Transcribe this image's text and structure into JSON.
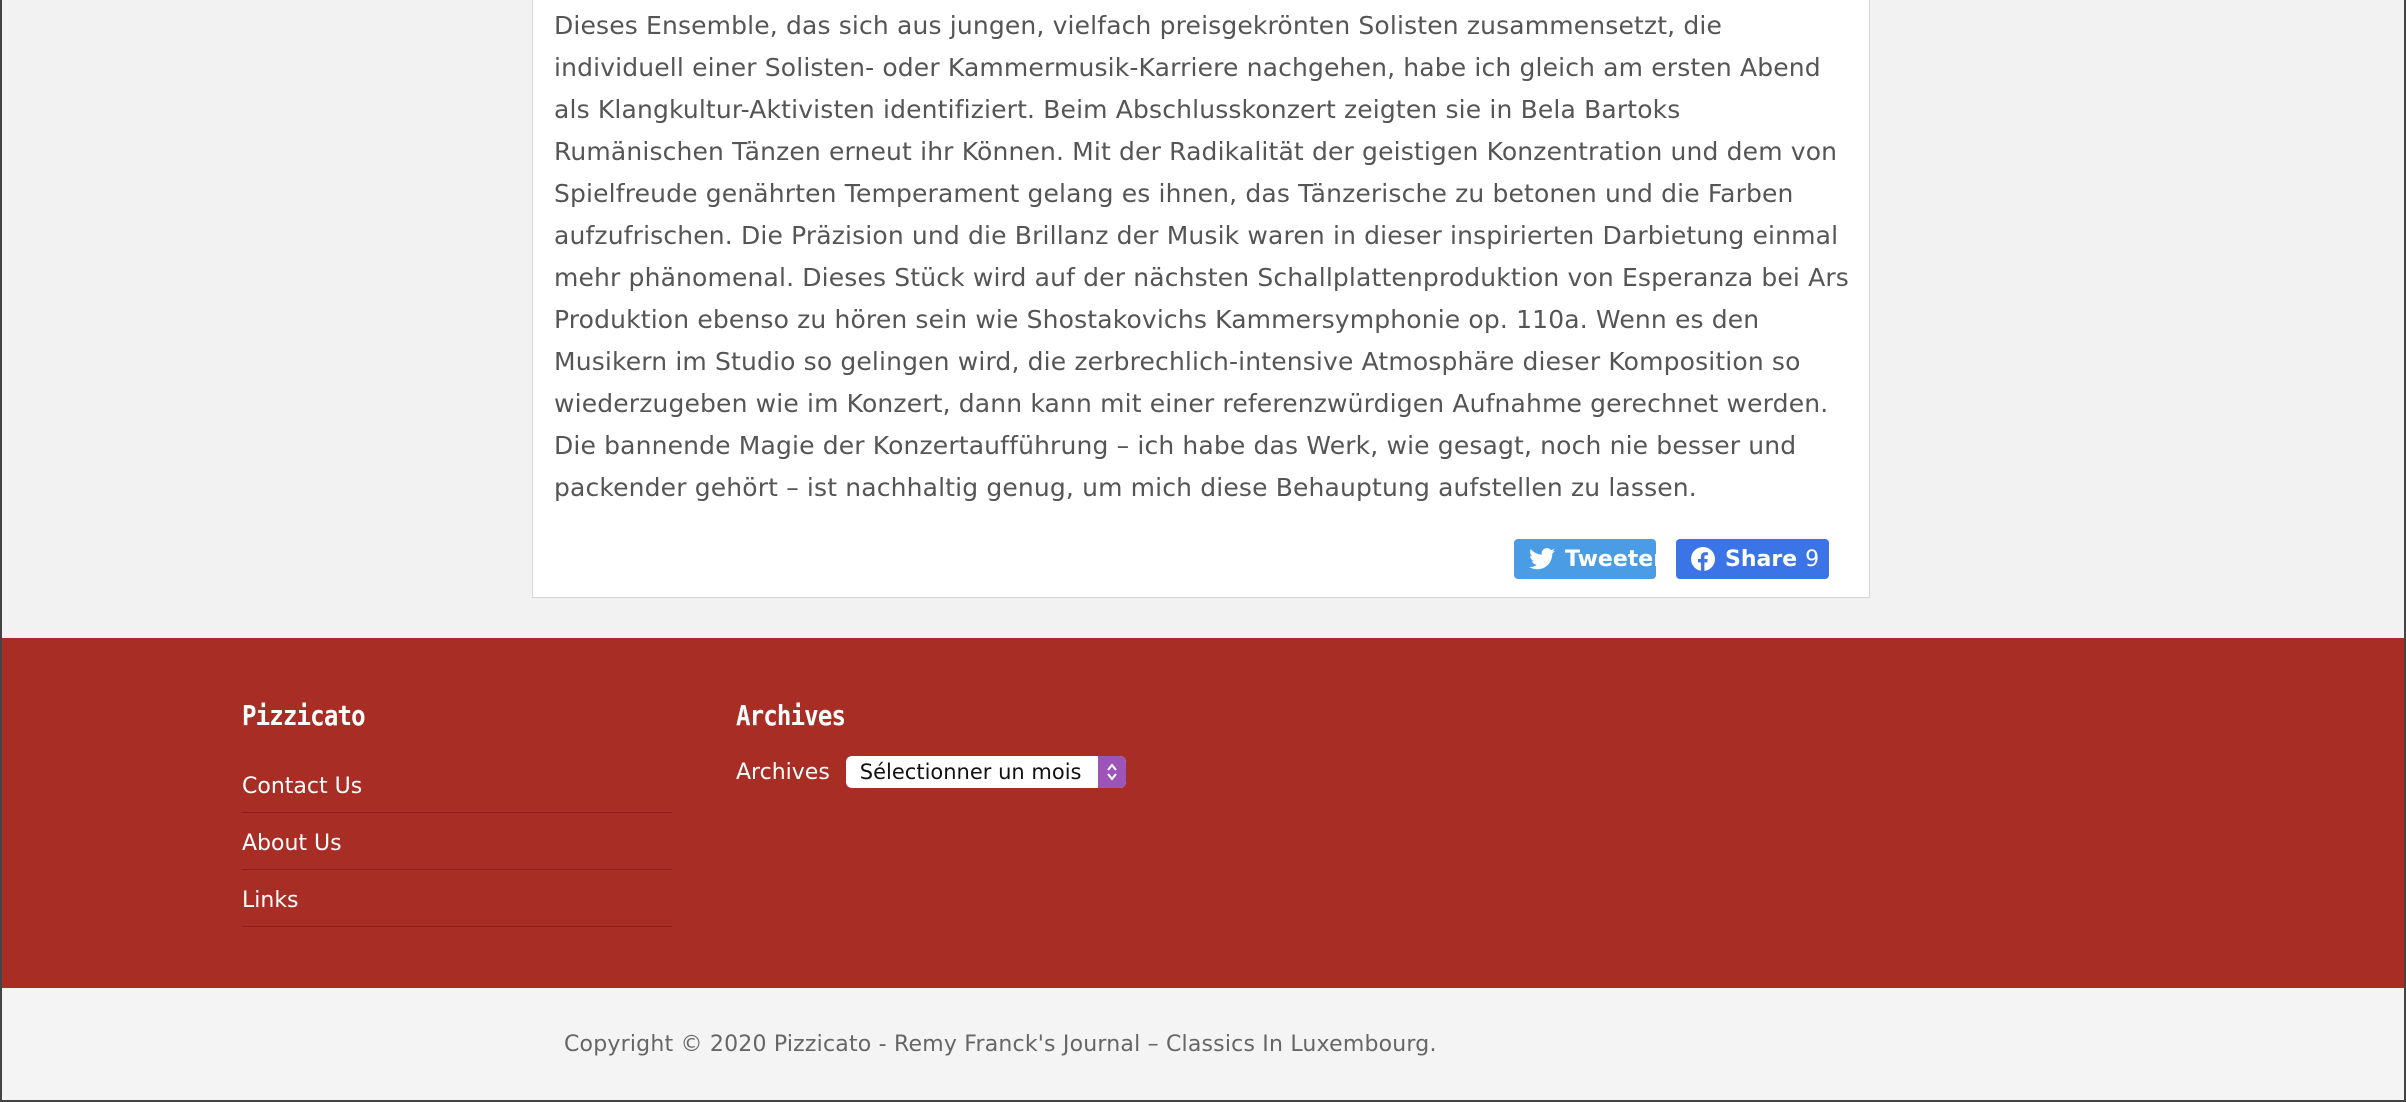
{
  "article": {
    "body": "Dieses Ensemble, das sich aus jungen, vielfach preisgekrönten Solisten zusammensetzt, die individuell einer Solisten- oder Kammermusik-Karriere nachgehen, habe ich gleich am ersten Abend als Klangkultur-Aktivisten identifiziert. Beim Abschlusskonzert zeigten sie in Bela Bartoks Rumänischen Tänzen erneut ihr Können. Mit der Radikalität der geistigen Konzentration und dem von Spielfreude genährten Temperament gelang es ihnen, das Tänzerische zu betonen und die Farben aufzufrischen. Die Präzision und die Brillanz der Musik waren in dieser inspirierten Darbietung einmal mehr phänomenal. Dieses Stück wird auf der nächsten Schallplattenproduktion von Esperanza bei Ars Produktion ebenso zu hören sein wie Shostakovichs Kammersymphonie op. 110a. Wenn es den Musikern im Studio so gelingen wird, die zerbrechlich-intensive Atmosphäre dieser Komposition so wiederzugeben wie im Konzert, dann kann mit einer referenzwürdigen Aufnahme gerechnet werden. Die bannende Magie der Konzertaufführung – ich habe das Werk, wie gesagt, noch nie besser und packender gehört –  ist nachhaltig genug, um mich diese Behauptung aufstellen zu lassen."
  },
  "share": {
    "tweet_label": "Tweeter",
    "facebook_label": "Share",
    "facebook_count": "9",
    "twitter_color": "#4a9de4",
    "facebook_color": "#3b74e6"
  },
  "footer": {
    "background_color": "#a82d24",
    "pizzicato": {
      "heading": "Pizzicato",
      "links": [
        "Contact Us",
        "About Us",
        "Links"
      ]
    },
    "archives": {
      "heading": "Archives",
      "label": "Archives",
      "selected_option": "Sélectionner un mois"
    }
  },
  "copyright": {
    "text": "Copyright © 2020 Pizzicato - Remy Franck's Journal – Classics In Luxembourg."
  }
}
